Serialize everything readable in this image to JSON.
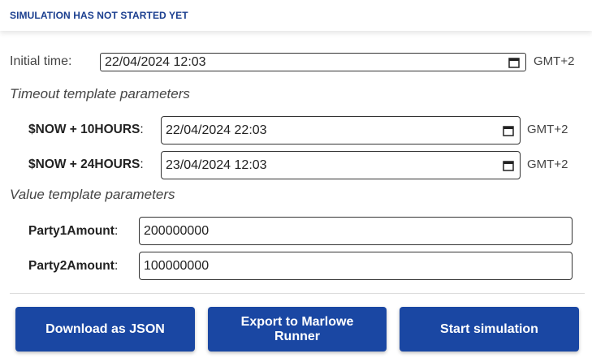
{
  "status": {
    "text": "SIMULATION HAS NOT STARTED YET"
  },
  "initial_time": {
    "label": "Initial time:",
    "value": "22/04/2024 12:03",
    "timezone": "GMT+2"
  },
  "timeout_section": {
    "title": "Timeout template parameters",
    "params": [
      {
        "name": "$NOW + 10HOURS",
        "colon": ":",
        "value": "22/04/2024 22:03",
        "timezone": "GMT+2"
      },
      {
        "name": "$NOW + 24HOURS",
        "colon": ":",
        "value": "23/04/2024 12:03",
        "timezone": "GMT+2"
      }
    ]
  },
  "value_section": {
    "title": "Value template parameters",
    "params": [
      {
        "name": "Party1Amount",
        "colon": ":",
        "value": "200000000"
      },
      {
        "name": "Party2Amount",
        "colon": ":",
        "value": "100000000"
      }
    ]
  },
  "buttons": {
    "download": "Download as JSON",
    "export_line1": "Export to Marlowe",
    "export_line2": "Runner",
    "start": "Start simulation"
  },
  "colors": {
    "accent": "#1a47a3",
    "status_text": "#1a3e8f"
  },
  "icons": {
    "calendar": "calendar-icon"
  }
}
